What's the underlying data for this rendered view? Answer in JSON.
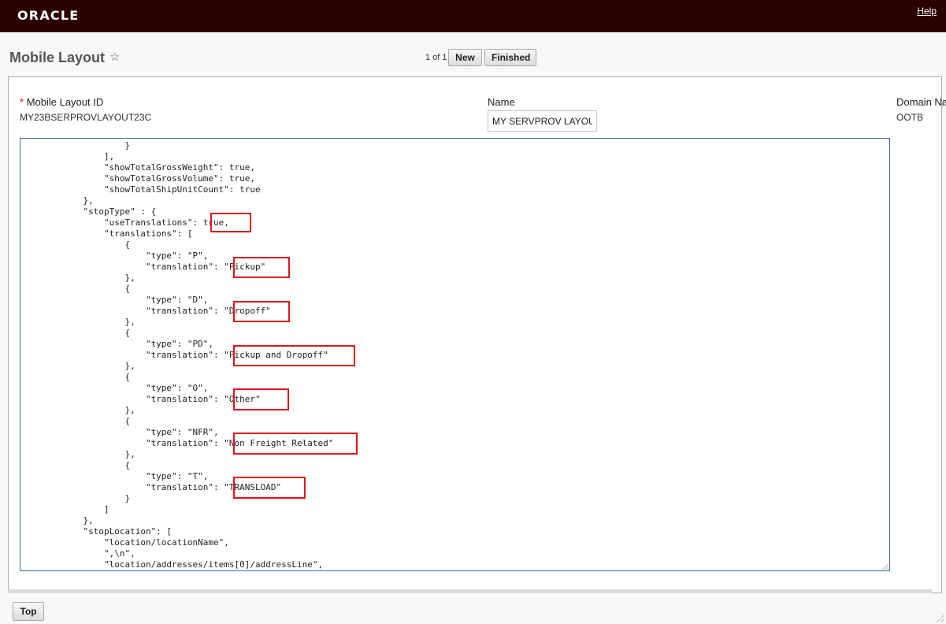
{
  "header": {
    "logo": "ORACLE",
    "help_label": "Help"
  },
  "page": {
    "title": "Mobile Layout",
    "star_icon": "☆"
  },
  "pager": {
    "text": "1 of 1"
  },
  "toolbar": {
    "new_label": "New",
    "finished_label": "Finished"
  },
  "form": {
    "required_marker": "*",
    "layout_id_label": "Mobile Layout ID",
    "layout_id_value": "MY23BSERPROVLAYOUT23C",
    "name_label": "Name",
    "name_value": "MY SERVPROV LAYOUT",
    "domain_label": "Domain Name",
    "domain_value": "OOTB"
  },
  "editor": {
    "lines": [
      "                    }",
      "                ],",
      "                \"showTotalGrossWeight\": true,",
      "                \"showTotalGrossVolume\": true,",
      "                \"showTotalShipUnitCount\": true",
      "            },",
      "            \"stopType\" : {",
      "                \"useTranslations\": true,",
      "                \"translations\": [",
      "                    {",
      "                        \"type\": \"P\",",
      "                        \"translation\": \"Pickup\"",
      "                    },",
      "                    {",
      "                        \"type\": \"D\",",
      "                        \"translation\": \"Dropoff\"",
      "                    },",
      "                    {",
      "                        \"type\": \"PD\",",
      "                        \"translation\": \"Pickup and Dropoff\"",
      "                    },",
      "                    {",
      "                        \"type\": \"O\",",
      "                        \"translation\": \"Other\"",
      "                    },",
      "                    {",
      "                        \"type\": \"NFR\",",
      "                        \"translation\": \"Non Freight Related\"",
      "                    },",
      "                    {",
      "                        \"type\": \"T\",",
      "                        \"translation\": \"TRANSLOAD\"",
      "                    }",
      "                ]",
      "            },",
      "            \"stopLocation\": [",
      "                \"location/locationName\",",
      "                \",\\n\",",
      "                \"location/addresses/items[0]/addressLine\","
    ]
  },
  "footer": {
    "top_label": "Top"
  },
  "colors": {
    "header_bg": "#2a0000",
    "highlight": "#e0141c",
    "required": "#c00000",
    "editor_border": "#3b6aa0"
  }
}
